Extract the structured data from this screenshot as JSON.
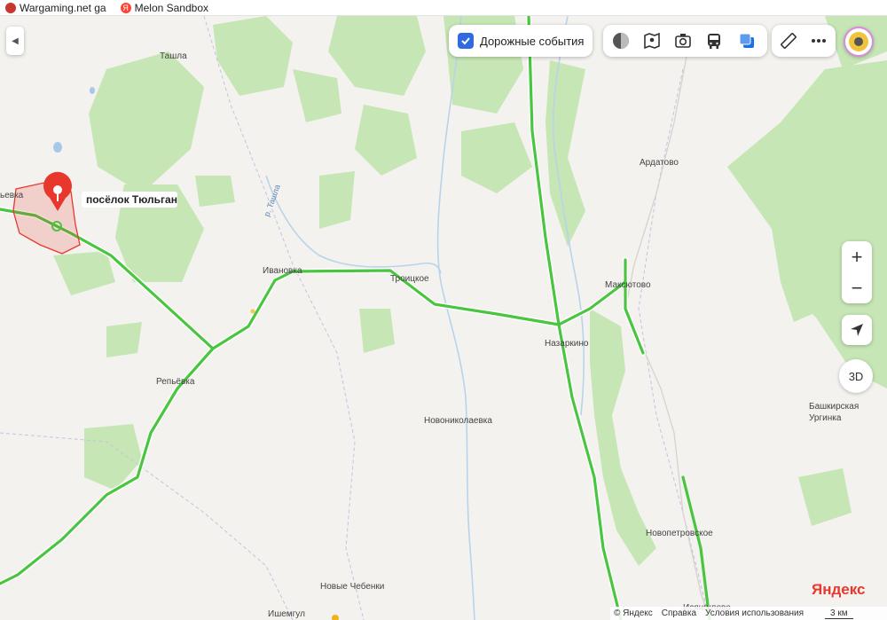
{
  "browser": {
    "bookmarks": [
      {
        "label": "Wargaming.net ga",
        "icon": "wargaming-icon"
      },
      {
        "label": "Melon Sandbox",
        "icon": "yandex-y-icon",
        "icon_glyph": "Я"
      }
    ]
  },
  "toolbar": {
    "traffic_events_label": "Дорожные события",
    "traffic_events_checked": true,
    "layer_icons": [
      "layers-icon",
      "panorama-icon",
      "photo-icon",
      "transit-icon",
      "map-style-icon"
    ],
    "ruler_icon": "ruler-icon",
    "more_icon": "more-icon"
  },
  "map": {
    "selected_place": "посёлок Тюльган",
    "places": [
      "Ташла",
      "Ардатово",
      "Ивановка",
      "Троицкое",
      "Максютово",
      "Назаркино",
      "Репьёвка",
      "Новониколаевка",
      "Башкирская",
      "Ургинка",
      "Новопетровское",
      "Новые Чебенки",
      "Ишемгул",
      "Исянгулово"
    ],
    "edge_place": "ьевка",
    "river": "р. Ташла"
  },
  "controls": {
    "zoom_in": "+",
    "zoom_out": "−",
    "mode_3d": "3D"
  },
  "footer": {
    "brand": "Яндекс",
    "copyright": "© Яндекс",
    "help": "Справка",
    "terms": "Условия использования",
    "scale": "3 км"
  },
  "colors": {
    "background": "#f3f2ef",
    "forest": "#c6e6b5",
    "road_green": "#49c53f",
    "marker_red": "#e8382d",
    "river": "#b9d3ea"
  }
}
